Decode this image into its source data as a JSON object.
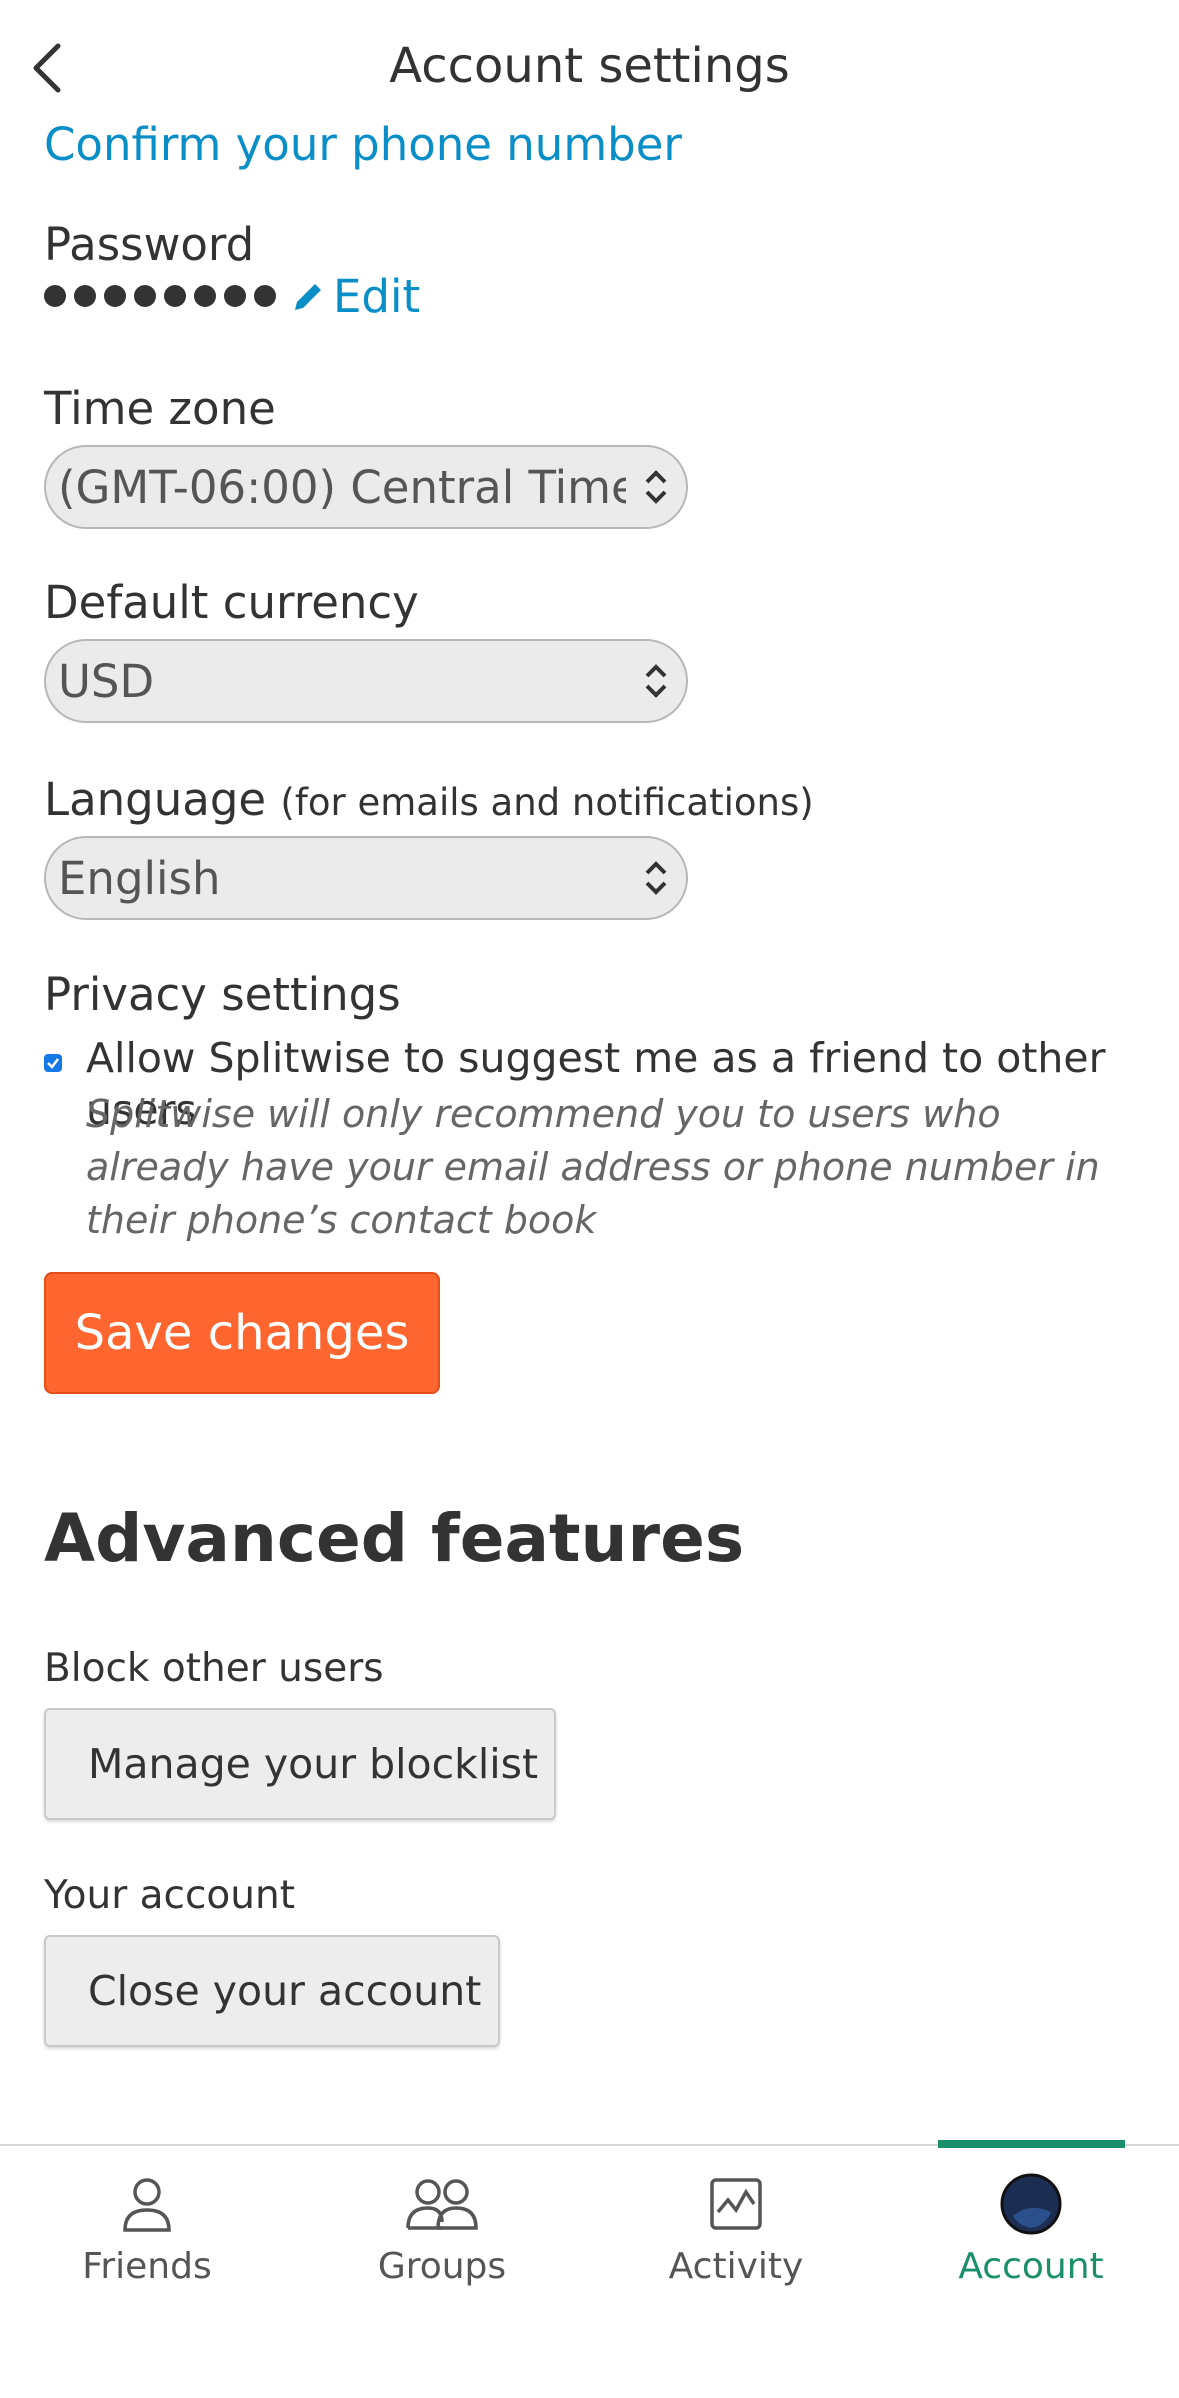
{
  "header": {
    "title": "Account settings"
  },
  "phone": {
    "confirm_link": "Confirm your phone number"
  },
  "password": {
    "label": "Password",
    "edit_label": "Edit"
  },
  "timezone": {
    "label": "Time zone",
    "value": "(GMT-06:00) Central Time ("
  },
  "currency": {
    "label": "Default currency",
    "value": "USD"
  },
  "language": {
    "label": "Language",
    "note": "(for emails and notifications)",
    "value": "English"
  },
  "privacy": {
    "label": "Privacy settings",
    "suggest_text": "Allow Splitwise to suggest me as a friend to other users",
    "note": "Splitwise will only recommend you to users who already have your email address or phone number in their phone’s contact book"
  },
  "save_label": "Save changes",
  "advanced": {
    "title": "Advanced features",
    "block_label": "Block other users",
    "blocklist_button": "Manage your blocklist",
    "account_label": "Your account",
    "close_button": "Close your account"
  },
  "tabs": [
    {
      "label": "Friends",
      "icon": "person-icon"
    },
    {
      "label": "Groups",
      "icon": "group-icon"
    },
    {
      "label": "Activity",
      "icon": "activity-icon"
    },
    {
      "label": "Account",
      "icon": "avatar-icon"
    }
  ],
  "colors": {
    "accent": "#1b8f6b",
    "save": "#ff652f",
    "link": "#0a8ec7"
  }
}
